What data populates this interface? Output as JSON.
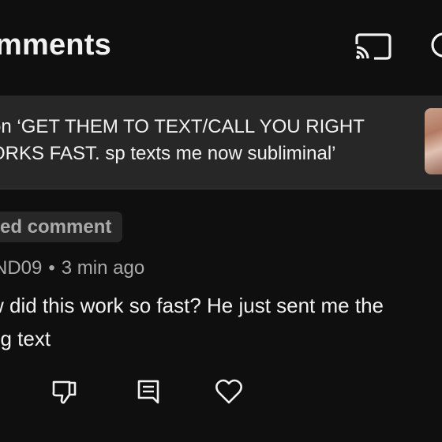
{
  "header": {
    "title": "mments",
    "cast_icon": "cast-icon",
    "search_icon": "search-icon"
  },
  "video": {
    "line1": "on ‘GET THEM TO TEXT/CALL YOU RIGHT",
    "line2": "ORKS FAST. sp texts me now subliminal’"
  },
  "comment": {
    "badge": "ed comment",
    "author": "ND09",
    "time": "3 min ago",
    "line1": "w did this work so fast? He just sent me the",
    "line2": "ng text"
  },
  "actions": {
    "dislike_icon": "thumbs-down-icon",
    "reply_icon": "reply-icon",
    "heart_icon": "heart-icon"
  },
  "colors": {
    "background": "#0f0f0f",
    "surface": "#272727",
    "text_primary": "#f1f1f1",
    "text_secondary": "#aaaaaa"
  }
}
